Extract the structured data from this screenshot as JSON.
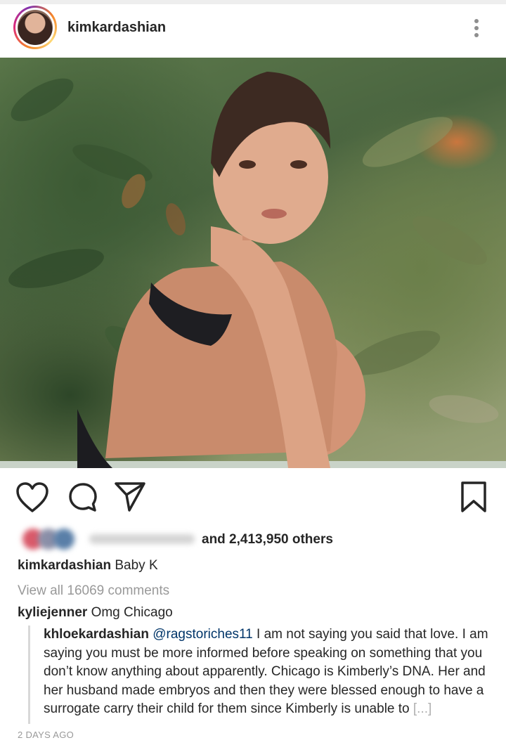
{
  "header": {
    "username": "kimkardashian"
  },
  "post": {
    "likes_text": "and 2,413,950 others",
    "caption_user": "kimkardashian",
    "caption_text": "Baby K",
    "view_all_comments": "View all 16069 comments"
  },
  "comments": [
    {
      "user": "kyliejenner",
      "text": "Omg Chicago"
    }
  ],
  "reply": {
    "user": "khloekardashian",
    "mention": "@ragstoriches11",
    "text": "I am not saying you said that love. I am saying you must be more informed before speaking on something that you don’t know anything about apparently. Chicago is Kimberly’s DNA. Her and her husband made embryos and then they were blessed enough to have a surrogate carry their child for them since Kimberly is unable to",
    "more_label": "[...]"
  },
  "timestamp": "2 DAYS AGO",
  "icons": {
    "like": "heart-icon",
    "comment": "comment-icon",
    "share": "paper-plane-icon",
    "save": "bookmark-icon",
    "options": "more-options-icon"
  },
  "colors": {
    "text": "#262626",
    "muted": "#999999",
    "mention": "#003569"
  }
}
